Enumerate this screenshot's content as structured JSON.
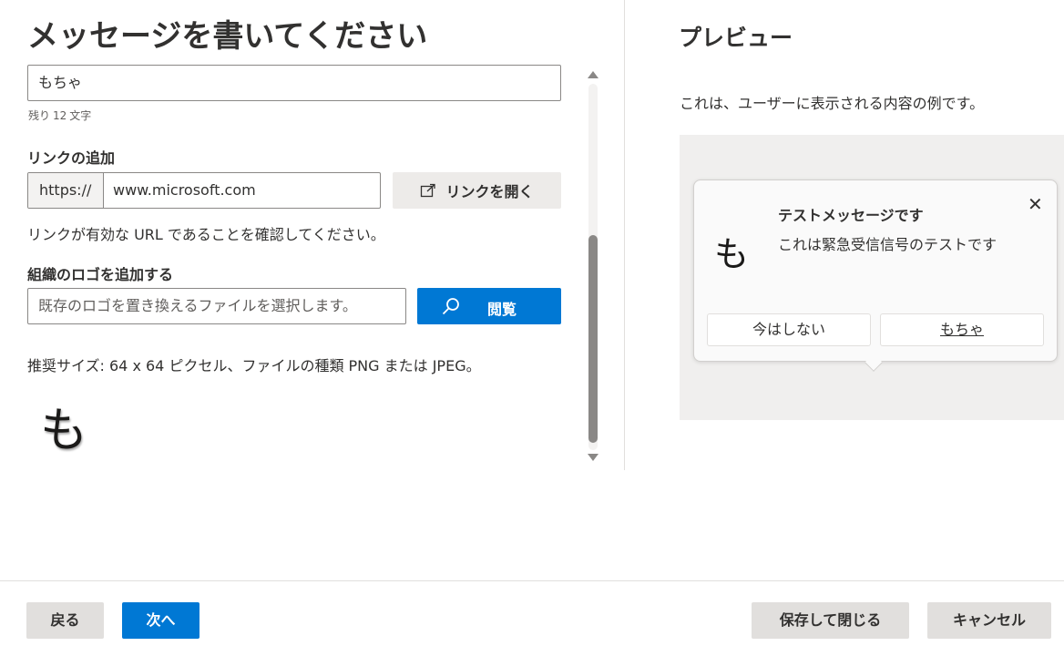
{
  "header": {
    "left_title": "メッセージを書いてください",
    "right_title": "プレビュー"
  },
  "message": {
    "value": "もちゃ",
    "remaining_label": "残り",
    "remaining_count": "12",
    "remaining_unit": "文字"
  },
  "link": {
    "label": "リンクの追加",
    "prefix": "https://",
    "value": "www.microsoft.com",
    "open_button": "リンクを開く",
    "hint": "リンクが有効な URL であることを確認してください。"
  },
  "logo": {
    "label": "組織のロゴを追加する",
    "file_placeholder": "既存のロゴを置き換えるファイルを選択します。",
    "browse_button": "閲覧",
    "size_note": "推奨サイズ: 64 x 64 ピクセル、ファイルの種類 PNG または JPEG。",
    "preview_char": "も"
  },
  "preview": {
    "description": "これは、ユーザーに表示される内容の例です。",
    "card": {
      "logo_char": "も",
      "title": "テストメッセージです",
      "body": "これは緊急受信信号のテストです",
      "close": "✕",
      "dismiss_button": "今はしない",
      "action_button": "もちゃ"
    }
  },
  "footer": {
    "back": "戻る",
    "next": "次へ",
    "save_close": "保存して閉じる",
    "cancel": "キャンセル"
  },
  "colors": {
    "primary": "#0078d4",
    "neutral_button": "#e1dfdd",
    "preview_background": "#f0efee"
  }
}
